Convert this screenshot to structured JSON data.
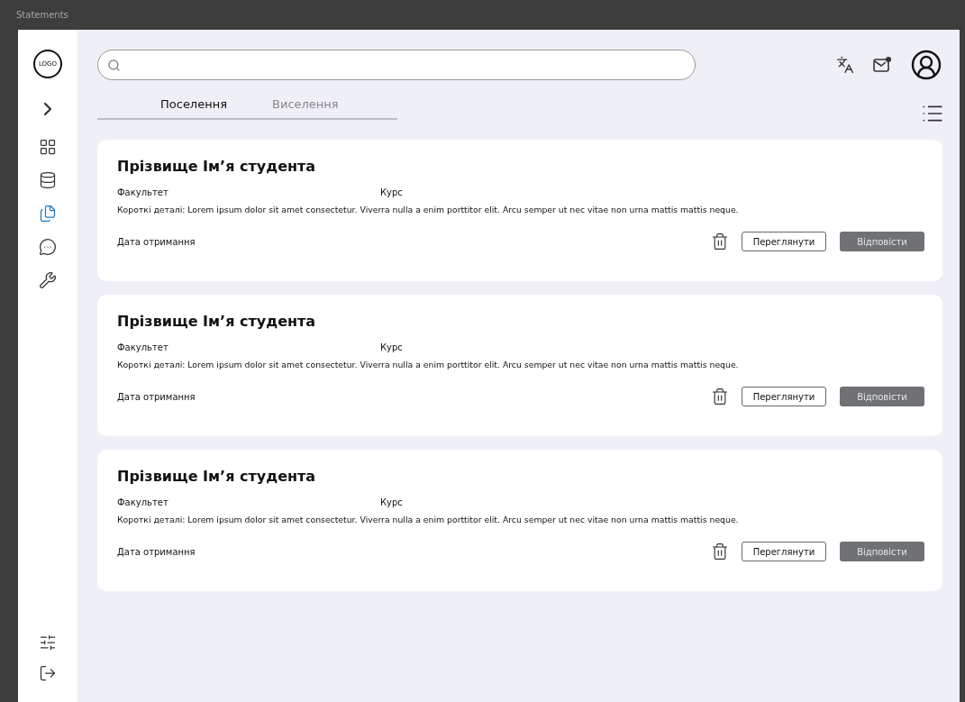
{
  "window": {
    "title": "Statements"
  },
  "sidebar": {
    "logo": "LOGO",
    "items": [
      {
        "kind": "grid",
        "selected": false
      },
      {
        "kind": "database",
        "selected": false
      },
      {
        "kind": "documents",
        "selected": true
      },
      {
        "kind": "chat",
        "selected": false
      },
      {
        "kind": "tools",
        "selected": false
      }
    ],
    "bottom_items": [
      {
        "kind": "settings"
      },
      {
        "kind": "logout"
      }
    ]
  },
  "tabs": [
    {
      "label": "Поселення",
      "selected": true
    },
    {
      "label": "Виселення",
      "selected": false
    }
  ],
  "cards": [
    {
      "name": "Прізвище Ім’я студента",
      "faculty": "Факультет",
      "course": "Курс",
      "details": "Короткі деталі: Lorem ipsum dolor sit amet consectetur. Viverra nulla a enim porttitor elit. Arcu semper ut nec vitae non urna mattis mattis neque.",
      "date": "Дата отримання",
      "view_button": "Переглянути",
      "reply_button": "Відповісти"
    },
    {
      "name": "Прізвище Ім’я студента",
      "faculty": "Факультет",
      "course": "Курс",
      "details": "Короткі деталі: Lorem ipsum dolor sit amet consectetur. Viverra nulla a enim porttitor elit. Arcu semper ut nec vitae non urna mattis mattis neque.",
      "date": "Дата отримання",
      "view_button": "Переглянути",
      "reply_button": "Відповісти"
    },
    {
      "name": "Прізвище Ім’я студента",
      "faculty": "Факультет",
      "course": "Курс",
      "details": "Короткі деталі: Lorem ipsum dolor sit amet consectetur. Viverra nulla a enim porttitor elit. Arcu semper ut nec vitae non urna mattis mattis neque.",
      "date": "Дата отримання",
      "view_button": "Переглянути",
      "reply_button": "Відповісти"
    }
  ]
}
